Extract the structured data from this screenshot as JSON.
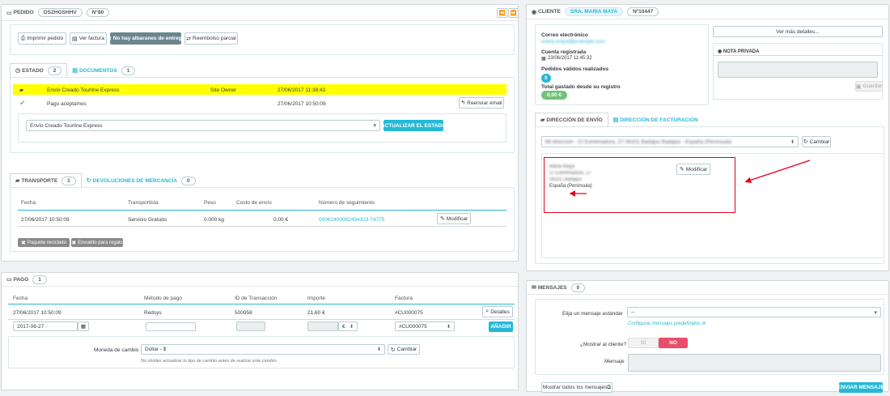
{
  "order": {
    "title": "PEDIDO",
    "reference": "OSZHGSHHV",
    "number": "N°80",
    "nav_prev": "⏪",
    "nav_next": "⏩",
    "actions": {
      "print": "Imprimir pedido",
      "invoice": "Ver factura",
      "no_delivery": "No hay albaranes de entrega",
      "refund": "Reembolso parcial"
    },
    "tabs": {
      "status": "ESTADO",
      "status_count": "2",
      "documents": "DOCUMENTOS",
      "documents_count": "1"
    },
    "history": [
      {
        "status": "Envío Creado Tourline Express",
        "employee": "Site Owner",
        "date": "27/06/2017 11:38:43"
      },
      {
        "status": "Pago aceptamos",
        "employee": "",
        "date": "27/06/2017 10:50:09",
        "action": "Reenviar email"
      }
    ],
    "status_select": "Envío Creado Tourline Express",
    "update_status": "ACTUALIZAR EL ESTADO"
  },
  "shipping": {
    "tabs": {
      "transport": "TRANSPORTE",
      "transport_count": "1",
      "returns": "DEVOLUCIONES DE MERCANCÍA",
      "returns_count": "0"
    },
    "headers": [
      "Fecha",
      "Transportista",
      "Peso",
      "Costo de envío",
      "Número de seguimiento"
    ],
    "row": {
      "date": "27/06/2017 10:50:09",
      "carrier": "Servicio Gratuito",
      "weight": "0.000 kg",
      "cost": "0,00 €",
      "tracking": "00062400062494323 74775",
      "action": "Modificar"
    },
    "recycled": "Paquete reciclado",
    "gift": "Envuelto para regalo"
  },
  "payment": {
    "title": "PAGO",
    "count": "1",
    "headers": [
      "Fecha",
      "Método de pago",
      "ID de Transacción",
      "Importe",
      "Factura"
    ],
    "row": {
      "date": "27/06/2017 10:50:09",
      "method": "Redsys",
      "transaction": "500958",
      "amount": "21,60 €",
      "invoice": "#CU000075",
      "action": "Detalles"
    },
    "new_date": "2017-06-27",
    "currency_symbol": "€",
    "new_invoice": "#CU000075",
    "add": "AÑADIR",
    "currency_label": "Moneda de cambio",
    "currency_value": "Dollar - $",
    "change": "Cambiar",
    "note": "No olvides actualizar tu tipo de cambio antes de realizar este cambio."
  },
  "customer": {
    "title": "CLIENTE",
    "name": "SRA. MARIA MAYA",
    "number": "Nº10447",
    "more": "Ver más detalles...",
    "email_label": "Correo electrónico",
    "email_value": "maria.maya@example.com",
    "registered_label": "Cuenta registrada",
    "registered_value": "23/06/2017 11:45:32",
    "orders_label": "Pedidos válidos realizados",
    "orders_value": "0",
    "spent_label": "Total gastado desde su registro",
    "spent_value": "0,00 €",
    "private_note": "NOTA PRIVADA",
    "save": "Guardar"
  },
  "address": {
    "tab_shipping": "DIRECCIÓN DE ENVÍO",
    "tab_billing": "DIRECCIÓN DE FACTURACIÓN",
    "select_value": "Mi dirección - C/ Extremadura, 27 06101 Badajoz Badajoz - España (Península)",
    "change": "Cambiar",
    "line1": "Maria Maya",
    "line2": "C/ Extremadura, 27",
    "line3": "06101 Badajoz",
    "country": "España (Península)",
    "modify": "Modificar"
  },
  "messages": {
    "title": "MENSAJES",
    "count": "0",
    "choose_label": "Elija un mensaje estándar",
    "choose_value": "--",
    "configure": "Configurar mensajes predefinidos",
    "show_label": "¿Mostrar al cliente?",
    "yes": "SÍ",
    "no": "NO",
    "message_label": "Mensaje",
    "show_all": "Mostrar todos los mensajes",
    "send": "ENVIAR MENSAJE"
  },
  "colors": {
    "accent": "#25b9d7",
    "highlight": "#ffff00",
    "danger": "#e84e6a",
    "annotation": "#e3001b"
  }
}
